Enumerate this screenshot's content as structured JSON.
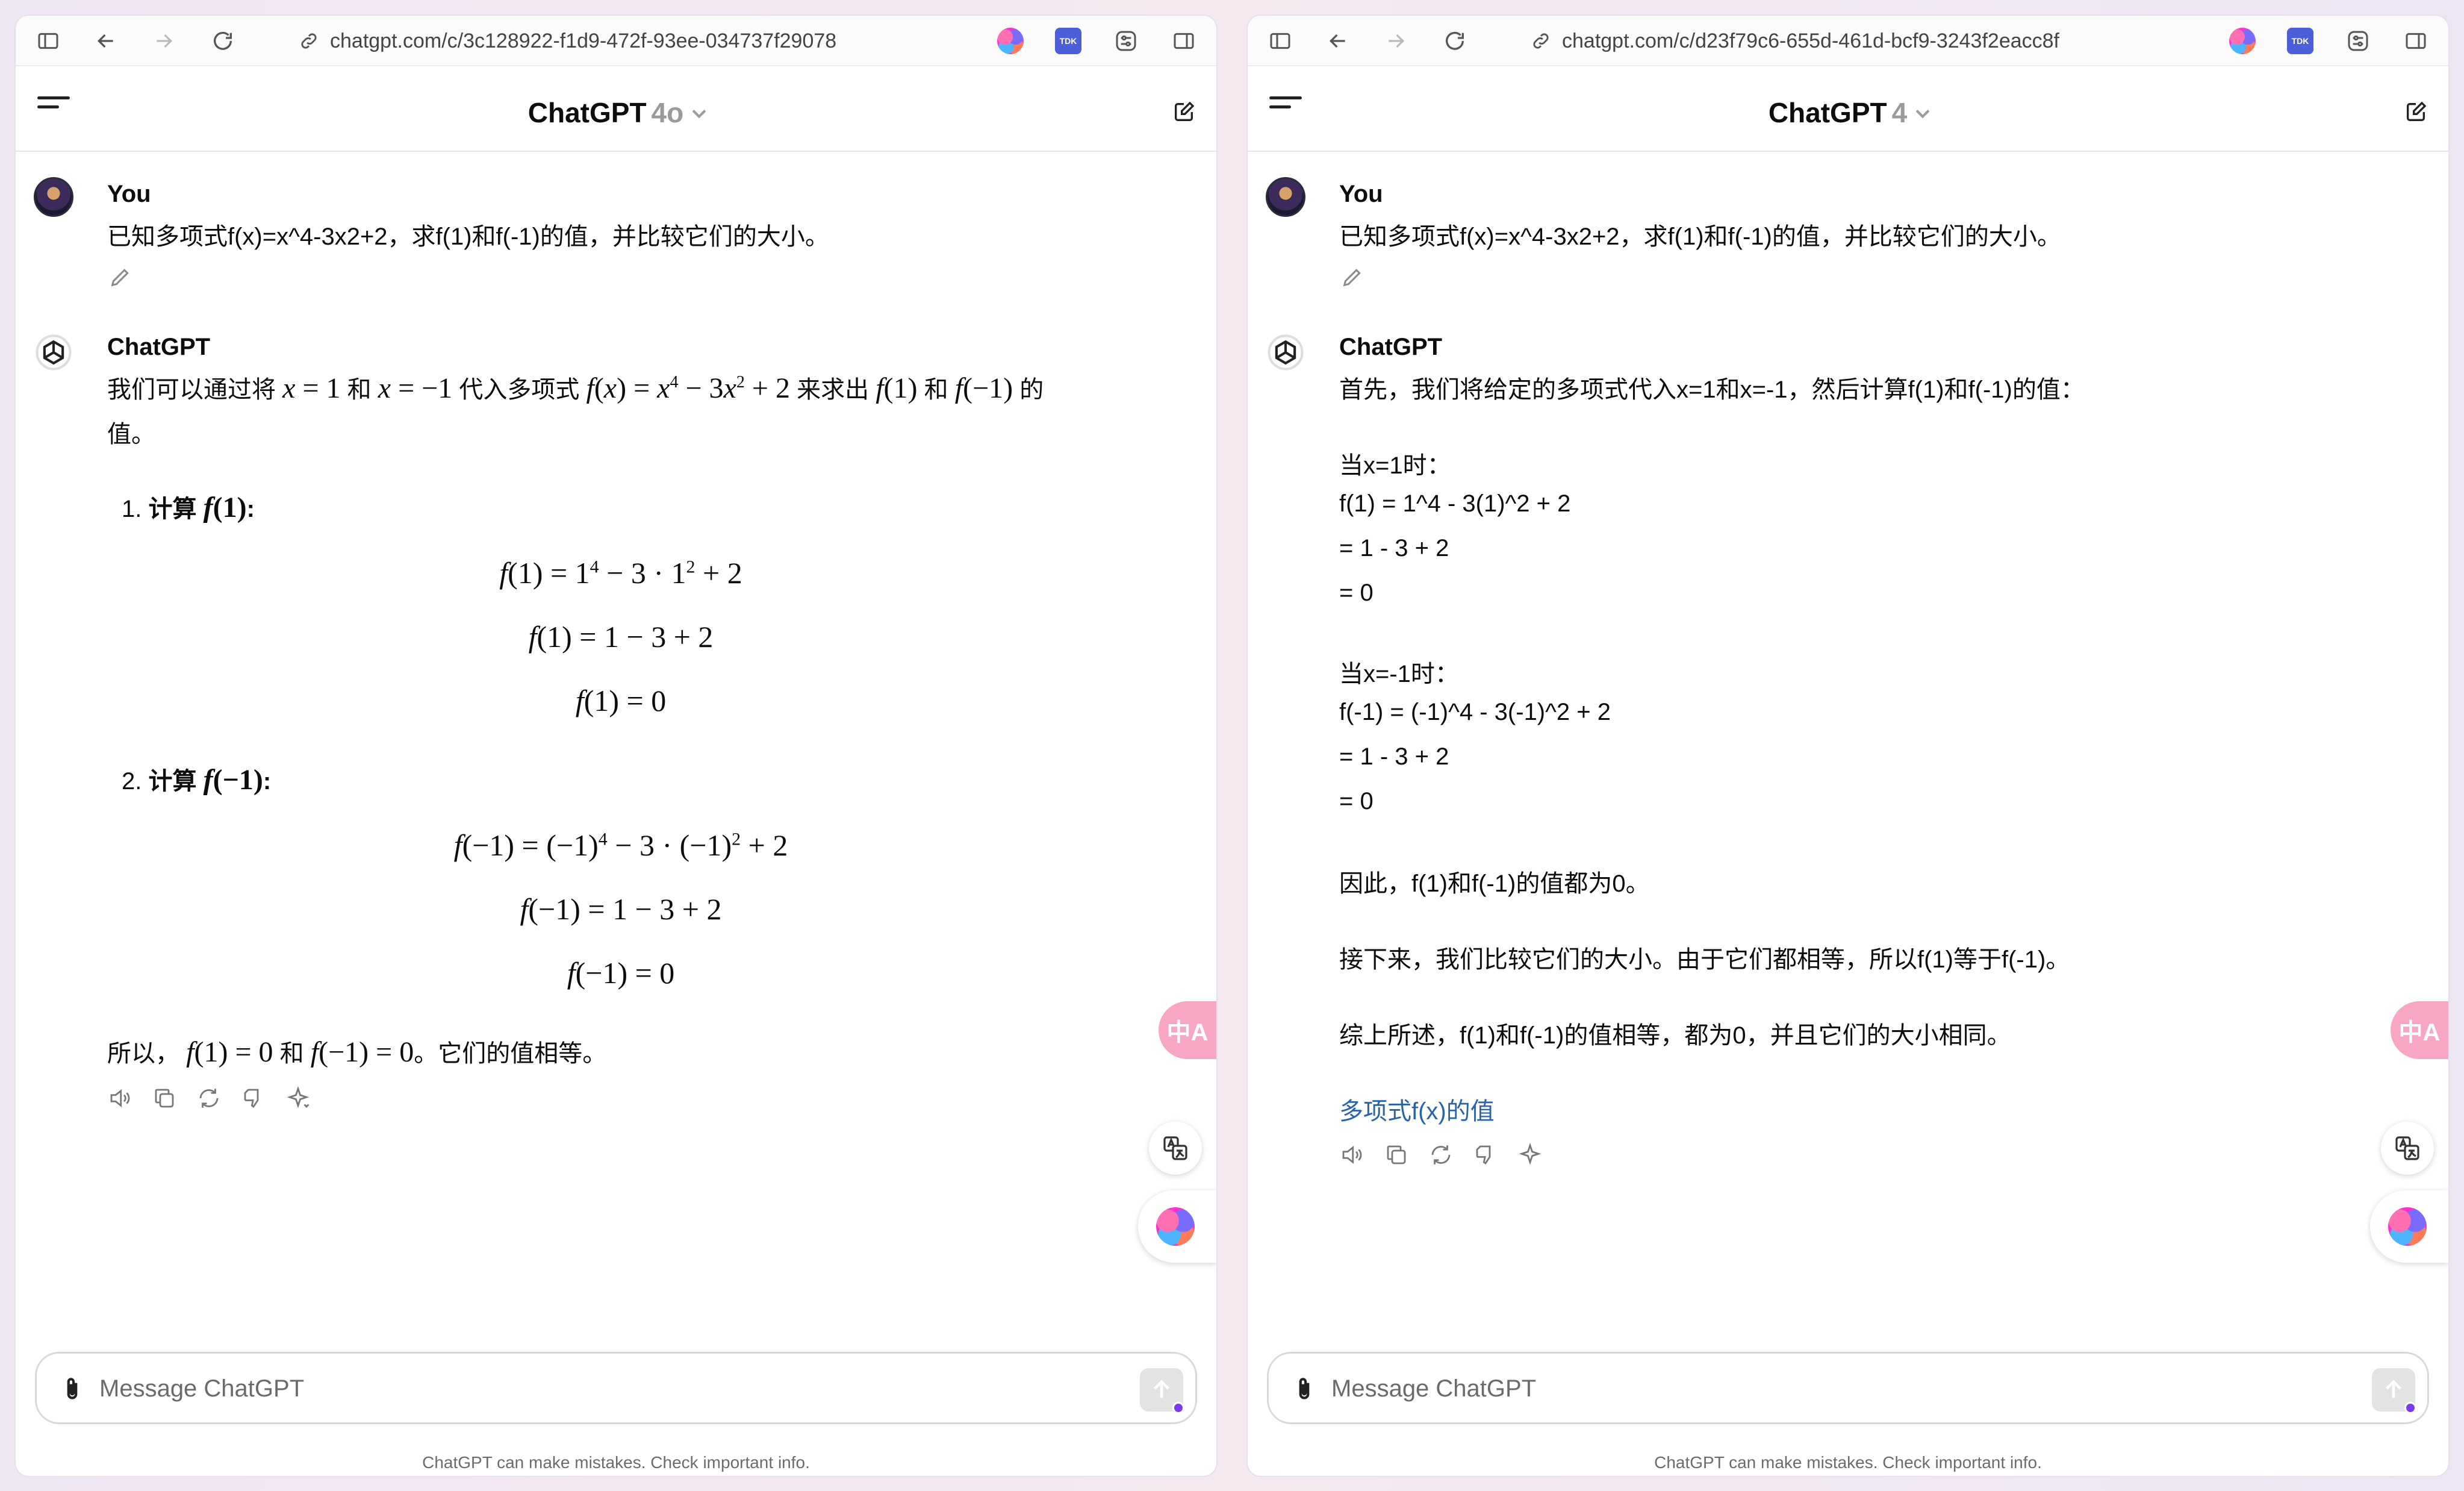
{
  "left": {
    "url": "chatgpt.com/c/3c128922-f1d9-472f-93ee-034737f29078",
    "model_name": "ChatGPT",
    "model_version": "4o",
    "user_name": "You",
    "user_message": "已知多项式f(x)=x^4-3x2+2，求f(1)和f(-1)的值，并比较它们的大小。",
    "bot_name": "ChatGPT",
    "intro_prefix": "我们可以通过将",
    "intro_and": "和",
    "intro_sub": "代入多项式",
    "intro_solve": "来求出",
    "intro_and2": "和",
    "intro_suffix": "的",
    "intro_line2": "值。",
    "step1_num": "1.",
    "step1_label": "计算",
    "step2_num": "2.",
    "step2_label": "计算",
    "conclusion_prefix": "所以，",
    "conclusion_and": "和",
    "conclusion_suffix": "。它们的值相等。",
    "tk_ext_label": "TDK",
    "translate_label": "中A",
    "composer_placeholder": "Message ChatGPT",
    "footer": "ChatGPT can make mistakes. Check important info."
  },
  "right": {
    "url": "chatgpt.com/c/d23f79c6-655d-461d-bcf9-3243f2eacc8f",
    "model_name": "ChatGPT",
    "model_version": "4",
    "user_name": "You",
    "user_message": "已知多项式f(x)=x^4-3x2+2，求f(1)和f(-1)的值，并比较它们的大小。",
    "bot_name": "ChatGPT",
    "lines": [
      "首先，我们将给定的多项式代入x=1和x=-1，然后计算f(1)和f(-1)的值：",
      "当x=1时：",
      "f(1) = 1^4 - 3(1)^2 + 2",
      "= 1 - 3 + 2",
      "= 0",
      "当x=-1时：",
      "f(-1) = (-1)^4 - 3(-1)^2 + 2",
      "= 1 - 3 + 2",
      "= 0",
      "因此，f(1)和f(-1)的值都为0。",
      "接下来，我们比较它们的大小。由于它们都相等，所以f(1)等于f(-1)。",
      "综上所述，f(1)和f(-1)的值相等，都为0，并且它们的大小相同。"
    ],
    "link_text": "多项式f(x)的值",
    "tk_ext_label": "TDK",
    "translate_label": "中A",
    "composer_placeholder": "Message ChatGPT",
    "footer": "ChatGPT can make mistakes. Check important info."
  }
}
